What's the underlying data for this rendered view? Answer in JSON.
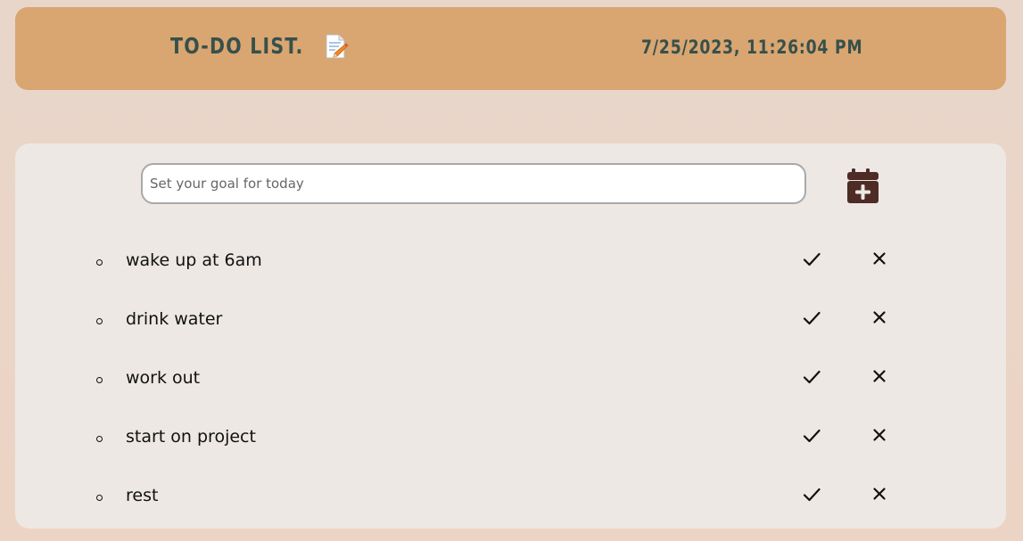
{
  "header": {
    "title": "TO-DO LIST.",
    "datetime": "7/25/2023, 11:26:04 PM"
  },
  "icons": {
    "title_icon": "memo-icon",
    "add": "calendar-plus-icon",
    "complete": "check-icon",
    "delete": "close-icon"
  },
  "colors": {
    "header_bg": "#d9a570",
    "header_text": "#36504c",
    "panel_bg": "#ede8e3",
    "add_icon": "#4f2b26"
  },
  "goal_input": {
    "placeholder": "Set your goal for today",
    "value": ""
  },
  "tasks": [
    {
      "label": "wake up at 6am"
    },
    {
      "label": "drink water"
    },
    {
      "label": "work out"
    },
    {
      "label": "start on project"
    },
    {
      "label": "rest"
    }
  ]
}
